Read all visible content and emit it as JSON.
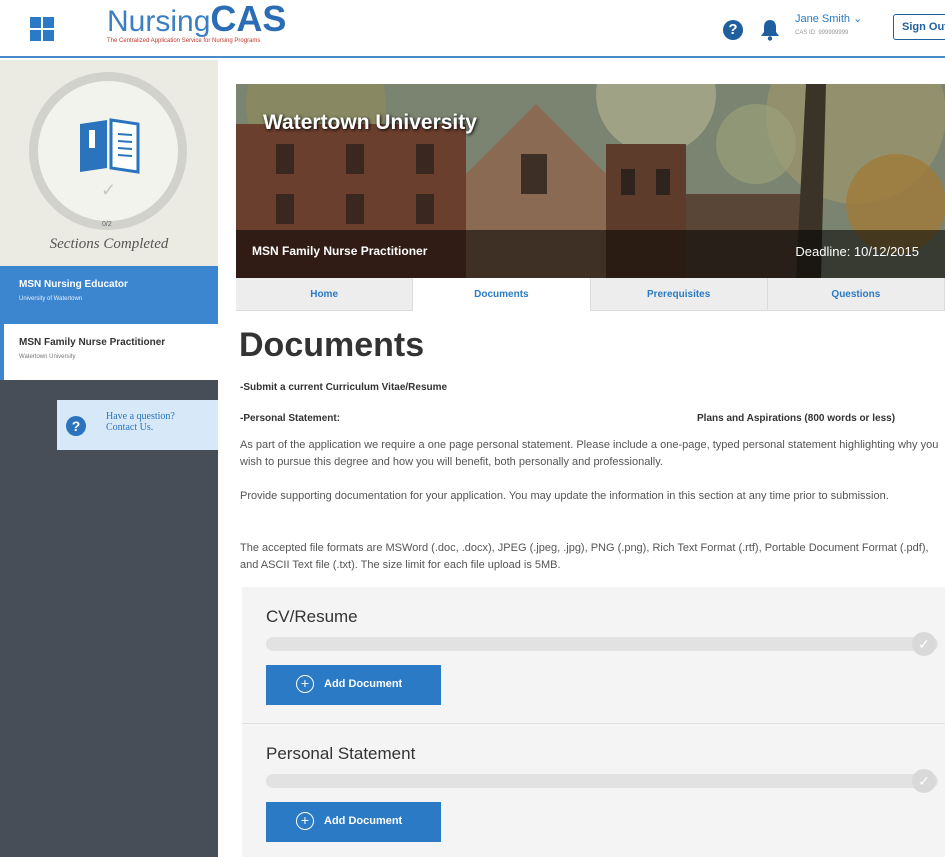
{
  "header": {
    "logo_text": "Nursing",
    "logo_bold": "CAS",
    "logo_tagline": "The Centralized Application Service for Nursing Programs",
    "user_name": "Jane Smith",
    "cas_id": "CAS ID: 999999999",
    "signout_label": "Sign Out",
    "icons": [
      "grid-icon",
      "help-icon",
      "bell-icon",
      "chevron-down-icon"
    ],
    "accent_color": "#2a7ac6"
  },
  "sidebar": {
    "progress_count": "0/2",
    "sections_label": "Sections Completed",
    "programs": [
      {
        "title": "MSN Nursing Educator",
        "school": "University of Watertown"
      },
      {
        "title": "MSN Family Nurse Practitioner",
        "school": "Watertown University"
      }
    ],
    "question_line1": "Have a question?",
    "question_line2": "Contact Us."
  },
  "banner": {
    "university": "Watertown University",
    "program": "MSN Family Nurse Practitioner",
    "deadline": "Deadline: 10/12/2015"
  },
  "tabs": [
    "Home",
    "Documents",
    "Prerequisites",
    "Questions"
  ],
  "active_tab": "Documents",
  "main": {
    "title": "Documents",
    "req1": "-Submit a current Curriculum Vitae/Resume",
    "req2_label": "-Personal Statement:",
    "req2_detail": "Plans and Aspirations (800 words or less)",
    "para1": "As part of the application we require a one page personal statement. Please include a one-page, typed personal statement highlighting why you wish to pursue this degree and how you will benefit, both personally and professionally.",
    "para2": "Provide supporting documentation for your application. You may update the information in this section at any time prior to submission.",
    "para3": "The accepted file formats are MSWord (.doc, .docx), JPEG (.jpeg, .jpg), PNG (.png), Rich Text Format (.rtf), Portable Document Format (.pdf), and ASCII Text file (.txt). The size limit for each file upload is 5MB.",
    "documents": [
      {
        "title": "CV/Resume",
        "button": "Add Document"
      },
      {
        "title": "Personal Statement",
        "button": "Add Document"
      }
    ]
  }
}
